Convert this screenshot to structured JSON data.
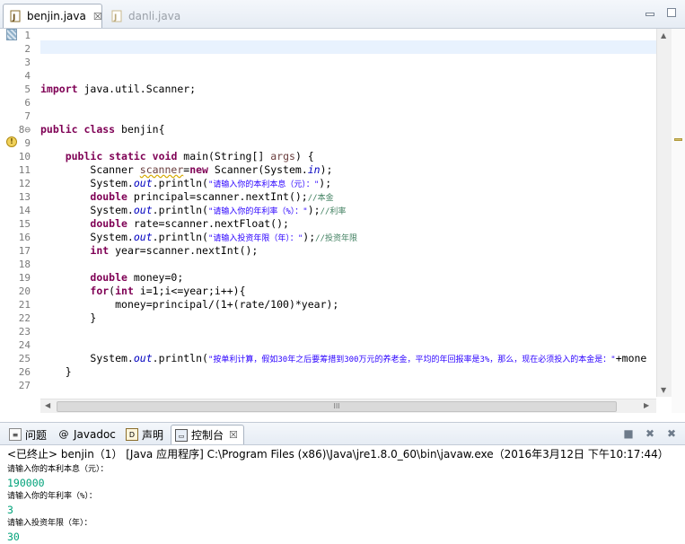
{
  "editor_tabs": [
    {
      "label": "benjin.java",
      "close": "☒",
      "active": true
    },
    {
      "label": "danli.java",
      "active": false
    }
  ],
  "code": {
    "line_numbers": [
      "1",
      "2",
      "3",
      "4",
      "5",
      "6",
      "7",
      "8⊖",
      "9",
      "10",
      "11",
      "12",
      "13",
      "14",
      "15",
      "16",
      "17",
      "18",
      "19",
      "20",
      "21",
      "22",
      "23",
      "24",
      "25",
      "26",
      "27"
    ],
    "l3_kw": "import",
    "l3_rest": " java.util.Scanner;",
    "l6_kw1": "public",
    "l6_kw2": "class",
    "l6_rest": " benjin{",
    "l8_ind": "    ",
    "l8_kw1": "public",
    "l8_kw2": "static",
    "l8_kw3": "void",
    "l8_rest1": " main(String[] ",
    "l8_var": "args",
    "l8_rest2": ") {",
    "l9_ind": "        ",
    "l9_a": "Scanner ",
    "l9_var": "scanner",
    "l9_b": "=",
    "l9_kw": "new",
    "l9_c": " Scanner(System.",
    "l9_fld": "in",
    "l9_d": ");",
    "l10_a": "System.",
    "l10_fld": "out",
    "l10_b": ".println(",
    "l10_str": "\"请输入你的本利本息（元）：\"",
    "l10_c": ");",
    "l11_kw": "double",
    "l11_a": " principal=scanner.nextInt();",
    "l11_cm": "//本金",
    "l12_a": "System.",
    "l12_fld": "out",
    "l12_b": ".println(",
    "l12_str": "\"请输入你的年利率（%）：\"",
    "l12_c": ");",
    "l12_cm": "//利率",
    "l13_kw": "double",
    "l13_a": " rate=scanner.nextFloat();",
    "l14_a": "System.",
    "l14_fld": "out",
    "l14_b": ".println(",
    "l14_str": "\"请输入投资年限（年）：\"",
    "l14_c": ");",
    "l14_cm": "//投资年限",
    "l15_kw": "int",
    "l15_a": " year=scanner.nextInt();",
    "l17_kw": "double",
    "l17_a": " money=0;",
    "l18_kw1": "for",
    "l18_a": "(",
    "l18_kw2": "int",
    "l18_b": " i=1;i<=year;i++){",
    "l19_ind": "            ",
    "l19_a": "money=principal/(1+(rate/100)*year);",
    "l20_a": "}",
    "l23_a": "System.",
    "l23_fld": "out",
    "l23_b": ".println(",
    "l23_str1": "\"按单利计算，假如30年之后要筹措到300万元的养老金，平均的年回报率是3%，那么，现在必须投入的本金是：\"",
    "l23_c": "+mone",
    "l24_a": "}",
    "l27_a": "}"
  },
  "console_tabs": [
    {
      "label": "问题",
      "icon": "problems-icon"
    },
    {
      "label": "Javadoc",
      "icon": "@"
    },
    {
      "label": "声明",
      "icon": "declaration-icon"
    },
    {
      "label": "控制台",
      "icon": "console-icon",
      "close": "☒",
      "active": true
    }
  ],
  "console": {
    "header": "<已终止> benjin（1）  [Java 应用程序] C:\\Program Files (x86)\\Java\\jre1.8.0_60\\bin\\javaw.exe（2016年3月12日 下午10:17:44）",
    "lines": [
      {
        "text": "请输入你的本利本息（元）：",
        "kind": "prompt"
      },
      {
        "text": "190000",
        "kind": "input"
      },
      {
        "text": "请输入你的年利率（%）：",
        "kind": "prompt"
      },
      {
        "text": "3",
        "kind": "input"
      },
      {
        "text": "请输入投资年限（年）：",
        "kind": "prompt"
      },
      {
        "text": "30",
        "kind": "input"
      }
    ]
  },
  "scroll": {
    "h_thumb_grip": "III"
  },
  "colors": {
    "keyword": "#7f0055",
    "string": "#2a00ff",
    "comment": "#3f7f5f",
    "field": "#0000c0",
    "console_input": "#00a27a"
  }
}
